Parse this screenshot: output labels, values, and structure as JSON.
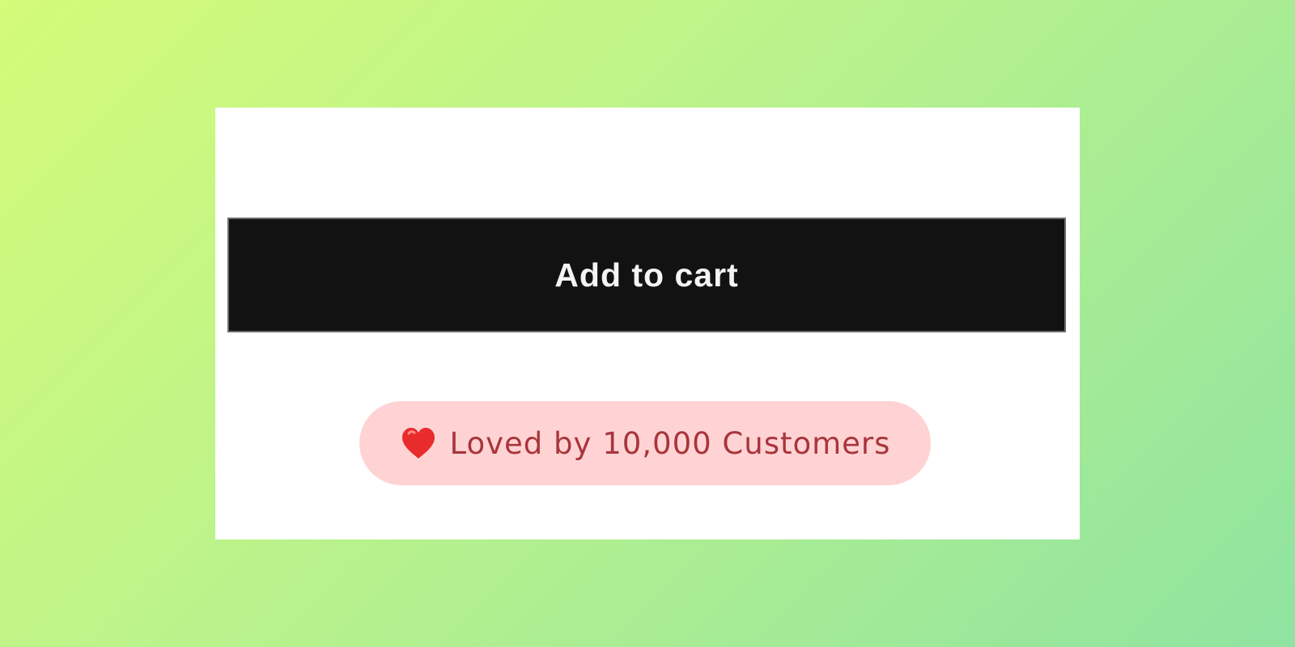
{
  "product_form": {
    "add_to_cart_label": "Add to cart"
  },
  "trust_badge": {
    "icon": "heart-icon",
    "text": "Loved by 10,000 Customers"
  },
  "colors": {
    "background_gradient_start": "#d4fb79",
    "background_gradient_end": "#8fe3a0",
    "button_background": "#121212",
    "button_text": "#f4f4f4",
    "badge_background": "#ffd3d3",
    "badge_text": "#a8353c",
    "heart": "#e82b2b"
  }
}
